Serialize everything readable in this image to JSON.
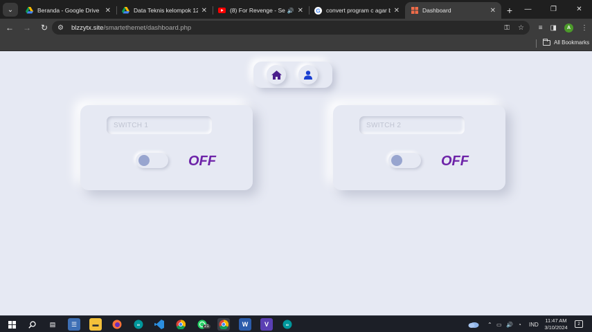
{
  "browser": {
    "tabs": [
      {
        "title": "Beranda - Google Drive",
        "icon": "google-drive-icon"
      },
      {
        "title": "Data Teknis kelompok 12(web",
        "icon": "google-drive-icon"
      },
      {
        "title": "(8) For Revenge - Serana",
        "icon": "youtube-icon",
        "audio": true
      },
      {
        "title": "convert program c agar ben",
        "icon": "google-icon"
      },
      {
        "title": "Dashboard",
        "icon": "dashboard-favicon",
        "active": true
      }
    ],
    "url_host": "blzzytx.site",
    "url_path": "/smartethemet/dashboard.php",
    "profile_initial": "A",
    "bookmarks_label": "All Bookmarks"
  },
  "dashboard": {
    "nav": [
      {
        "name": "home",
        "icon": "home-icon"
      },
      {
        "name": "profile",
        "icon": "user-icon"
      }
    ],
    "switches": [
      {
        "label_placeholder": "SWITCH 1",
        "state": "OFF",
        "on": false
      },
      {
        "label_placeholder": "SWITCH 2",
        "state": "OFF",
        "on": false
      }
    ],
    "colors": {
      "background": "#e6e9f3",
      "state_text": "#6d23a8",
      "knob": "#98a5cf",
      "home_icon": "#4b1f8c",
      "user_icon": "#1a3fd1"
    }
  },
  "taskbar": {
    "whatsapp_badge": "21",
    "language": "IND",
    "time": "11:47 AM",
    "date": "3/10/2024",
    "notifications": "2"
  }
}
